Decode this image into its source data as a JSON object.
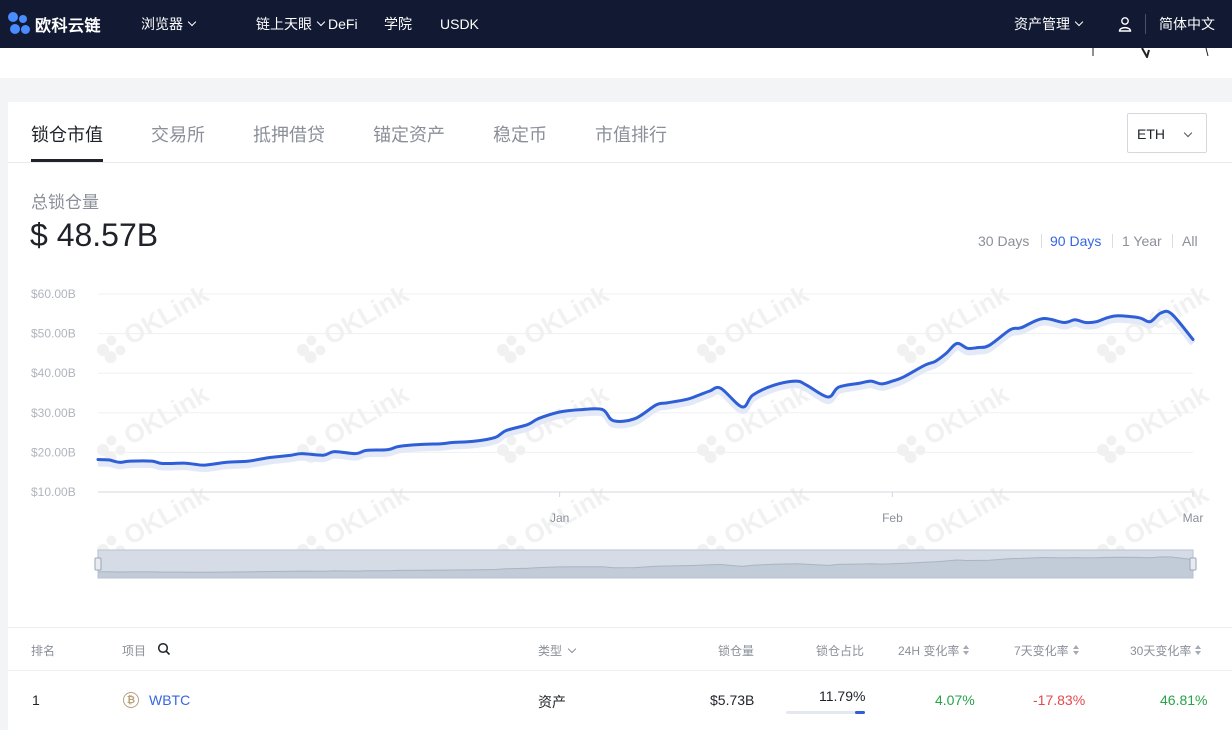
{
  "nav": {
    "brand": "欧科云链",
    "items": [
      {
        "label": "浏览器",
        "dropdown": true
      },
      {
        "label": "链上天眼",
        "dropdown": true
      },
      {
        "label": "DeFi",
        "dropdown": false
      },
      {
        "label": "学院",
        "dropdown": false
      },
      {
        "label": "USDK",
        "dropdown": false
      }
    ],
    "asset_menu": "资产管理",
    "language": "简体中文",
    "colors": {
      "bg": "#121a33",
      "brand": "#4a8cff"
    }
  },
  "tabs": [
    {
      "label": "锁仓市值",
      "active": true
    },
    {
      "label": "交易所",
      "active": false
    },
    {
      "label": "抵押借贷",
      "active": false
    },
    {
      "label": "锚定资产",
      "active": false
    },
    {
      "label": "稳定币",
      "active": false
    },
    {
      "label": "市值排行",
      "active": false
    }
  ],
  "chain_select": {
    "value": "ETH"
  },
  "summary": {
    "label": "总锁仓量",
    "value": "$ 48.57B"
  },
  "time_ranges": [
    {
      "label": "30 Days",
      "active": false
    },
    {
      "label": "90 Days",
      "active": true
    },
    {
      "label": "1 Year",
      "active": false
    },
    {
      "label": "All",
      "active": false
    }
  ],
  "watermark": "OKLink",
  "chart_data": {
    "type": "line",
    "title": "",
    "xlabel": "",
    "ylabel": "",
    "x_tick_labels": [
      "Jan",
      "Feb",
      "Mar"
    ],
    "y_tick_labels": [
      "$60.00B",
      "$50.00B",
      "$40.00B",
      "$30.00B",
      "$20.00B",
      "$10.00B"
    ],
    "y_ticks": [
      60,
      50,
      40,
      30,
      20,
      10
    ],
    "ylim": [
      10,
      60
    ],
    "x_range_days": [
      -43,
      59
    ],
    "grid": true,
    "legend": "none",
    "color": "#2f5fd6",
    "series": [
      {
        "x": [
          -43,
          -42,
          -41,
          -40,
          -38,
          -37,
          -35,
          -34,
          -33,
          -31,
          -29,
          -27,
          -25,
          -24,
          -22,
          -21,
          -19,
          -18,
          -16,
          -15,
          -13,
          -11,
          -10,
          -8,
          -6,
          -5,
          -3,
          -2,
          0,
          2,
          4,
          5,
          7,
          9,
          10,
          12,
          13,
          14,
          15,
          17,
          18,
          20,
          22,
          23,
          25,
          26,
          28,
          29,
          30,
          31,
          32,
          34,
          35,
          36,
          37,
          38,
          39,
          40,
          42,
          43,
          45,
          47,
          48,
          49,
          50,
          51,
          52,
          54,
          55,
          56,
          57,
          59
        ],
        "values": [
          18.2,
          18.1,
          17.5,
          17.8,
          17.8,
          17.2,
          17.3,
          17.0,
          16.8,
          17.5,
          17.8,
          18.7,
          19.3,
          19.7,
          19.3,
          20.2,
          19.7,
          20.5,
          20.7,
          21.5,
          22.0,
          22.2,
          22.5,
          22.8,
          23.8,
          25.5,
          27.0,
          28.5,
          30.2,
          30.8,
          30.8,
          28.0,
          28.5,
          32.0,
          32.5,
          33.5,
          34.5,
          35.5,
          36.2,
          31.5,
          34.5,
          37.0,
          38.0,
          37.0,
          34.0,
          36.5,
          37.5,
          38.0,
          37.3,
          38.0,
          39.0,
          42.0,
          43.0,
          45.0,
          47.5,
          46.3,
          46.5,
          47.0,
          51.0,
          51.5,
          53.8,
          52.8,
          53.5,
          52.8,
          53.0,
          54.0,
          54.5,
          54.0,
          53.0,
          55.2,
          55.0,
          48.5
        ]
      }
    ],
    "last_value": 48.5
  },
  "navigator": {
    "range": "full"
  },
  "table": {
    "headers": {
      "rank": "排名",
      "project": "项目",
      "type": "类型",
      "locked": "锁仓量",
      "share": "锁仓占比",
      "change_24h": "24H 变化率",
      "change_7d": "7天变化率",
      "change_30d": "30天变化率"
    },
    "rows": [
      {
        "rank": "1",
        "project": "WBTC",
        "icon": "bitcoin-icon",
        "type": "资产",
        "locked": "$5.73B",
        "share": "11.79%",
        "share_fraction": 0.1179,
        "change_24h": "4.07%",
        "change_7d": "-17.83%",
        "change_30d": "46.81%"
      }
    ]
  }
}
